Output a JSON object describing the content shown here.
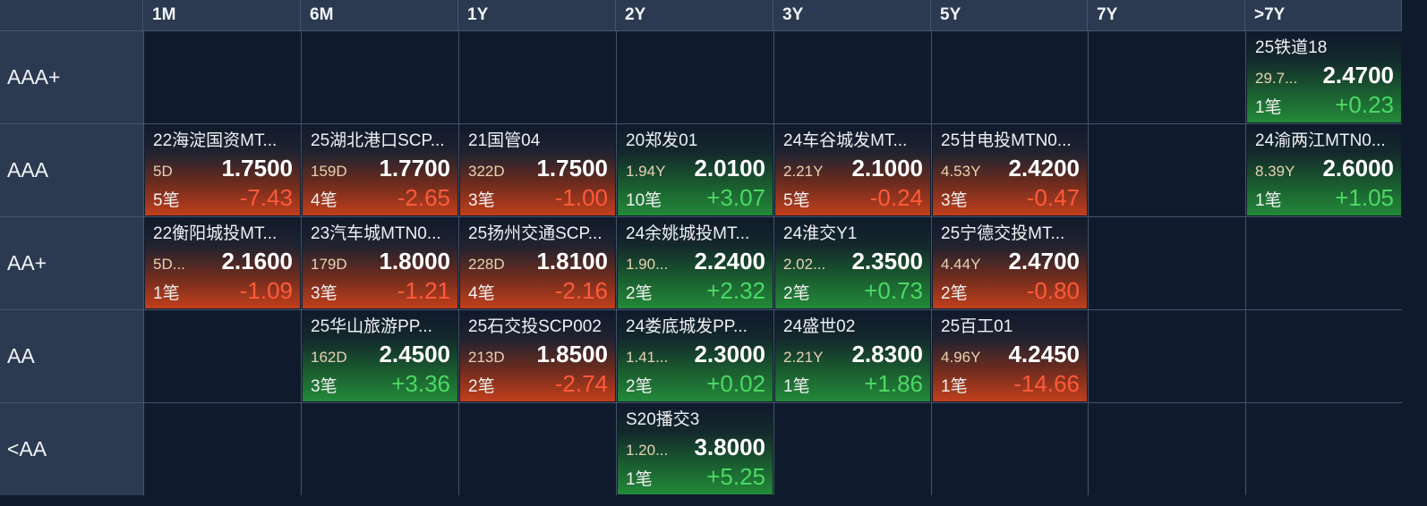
{
  "columns": [
    "1M",
    "6M",
    "1Y",
    "2Y",
    "3Y",
    "5Y",
    "7Y",
    ">7Y"
  ],
  "rows": [
    {
      "label": "AAA+",
      "cells": [
        null,
        null,
        null,
        null,
        null,
        null,
        null,
        {
          "name": "25铁道18",
          "term": "29.7...",
          "yield": "2.4700",
          "count": "1笔",
          "change": "+0.23",
          "trend": "green"
        }
      ]
    },
    {
      "label": "AAA",
      "cells": [
        {
          "name": "22海淀国资MT...",
          "term": "5D",
          "yield": "1.7500",
          "count": "5笔",
          "change": "-7.43",
          "trend": "red"
        },
        {
          "name": "25湖北港口SCP...",
          "term": "159D",
          "yield": "1.7700",
          "count": "4笔",
          "change": "-2.65",
          "trend": "red"
        },
        {
          "name": "21国管04",
          "term": "322D",
          "yield": "1.7500",
          "count": "3笔",
          "change": "-1.00",
          "trend": "red"
        },
        {
          "name": "20郑发01",
          "term": "1.94Y",
          "yield": "2.0100",
          "count": "10笔",
          "change": "+3.07",
          "trend": "green"
        },
        {
          "name": "24车谷城发MT...",
          "term": "2.21Y",
          "yield": "2.1000",
          "count": "5笔",
          "change": "-0.24",
          "trend": "red"
        },
        {
          "name": "25甘电投MTN0...",
          "term": "4.53Y",
          "yield": "2.4200",
          "count": "3笔",
          "change": "-0.47",
          "trend": "red"
        },
        null,
        {
          "name": "24渝两江MTN0...",
          "term": "8.39Y",
          "yield": "2.6000",
          "count": "1笔",
          "change": "+1.05",
          "trend": "green"
        }
      ]
    },
    {
      "label": "AA+",
      "cells": [
        {
          "name": "22衡阳城投MT...",
          "term": "5D...",
          "yield": "2.1600",
          "count": "1笔",
          "change": "-1.09",
          "trend": "red"
        },
        {
          "name": "23汽车城MTN0...",
          "term": "179D",
          "yield": "1.8000",
          "count": "3笔",
          "change": "-1.21",
          "trend": "red"
        },
        {
          "name": "25扬州交通SCP...",
          "term": "228D",
          "yield": "1.8100",
          "count": "4笔",
          "change": "-2.16",
          "trend": "red"
        },
        {
          "name": "24余姚城投MT...",
          "term": "1.90...",
          "yield": "2.2400",
          "count": "2笔",
          "change": "+2.32",
          "trend": "green"
        },
        {
          "name": "24淮交Y1",
          "term": "2.02...",
          "yield": "2.3500",
          "count": "2笔",
          "change": "+0.73",
          "trend": "green"
        },
        {
          "name": "25宁德交投MT...",
          "term": "4.44Y",
          "yield": "2.4700",
          "count": "2笔",
          "change": "-0.80",
          "trend": "red"
        },
        null,
        null
      ]
    },
    {
      "label": "AA",
      "cells": [
        null,
        {
          "name": "25华山旅游PP...",
          "term": "162D",
          "yield": "2.4500",
          "count": "3笔",
          "change": "+3.36",
          "trend": "green"
        },
        {
          "name": "25石交投SCP002",
          "term": "213D",
          "yield": "1.8500",
          "count": "2笔",
          "change": "-2.74",
          "trend": "red"
        },
        {
          "name": "24娄底城发PP...",
          "term": "1.41...",
          "yield": "2.3000",
          "count": "2笔",
          "change": "+0.02",
          "trend": "green"
        },
        {
          "name": "24盛世02",
          "term": "2.21Y",
          "yield": "2.8300",
          "count": "1笔",
          "change": "+1.86",
          "trend": "green"
        },
        {
          "name": "25百工01",
          "term": "4.96Y",
          "yield": "4.2450",
          "count": "1笔",
          "change": "-14.66",
          "trend": "red"
        },
        null,
        null
      ]
    },
    {
      "label": "<AA",
      "cells": [
        null,
        null,
        null,
        {
          "name": "S20播交3",
          "term": "1.20...",
          "yield": "3.8000",
          "count": "1笔",
          "change": "+5.25",
          "trend": "green"
        },
        null,
        null,
        null,
        null
      ]
    }
  ]
}
